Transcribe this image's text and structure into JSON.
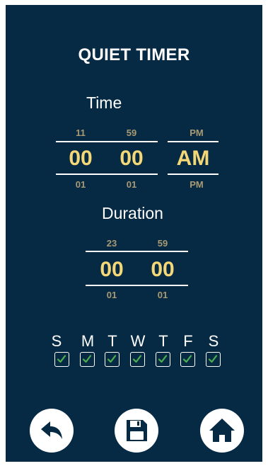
{
  "title": "QUIET TIMER",
  "time": {
    "label": "Time",
    "hour": {
      "prev": "11",
      "value": "00",
      "next": "01"
    },
    "minute": {
      "prev": "59",
      "value": "00",
      "next": "01"
    },
    "ampm": {
      "prev": "PM",
      "value": "AM",
      "next": "PM"
    }
  },
  "duration": {
    "label": "Duration",
    "hours": {
      "prev": "23",
      "value": "00",
      "next": "01"
    },
    "minutes": {
      "prev": "59",
      "value": "00",
      "next": "01"
    }
  },
  "days": [
    {
      "letter": "S",
      "checked": true
    },
    {
      "letter": "M",
      "checked": true
    },
    {
      "letter": "T",
      "checked": true
    },
    {
      "letter": "W",
      "checked": true
    },
    {
      "letter": "T",
      "checked": true
    },
    {
      "letter": "F",
      "checked": true
    },
    {
      "letter": "S",
      "checked": true
    }
  ],
  "buttons": {
    "back": "back-arrow-icon",
    "save": "floppy-disk-icon",
    "home": "home-icon"
  },
  "colors": {
    "background": "#062a44",
    "value": "#f4d877",
    "adjacent": "#a99a73",
    "check": "#4caf50"
  }
}
